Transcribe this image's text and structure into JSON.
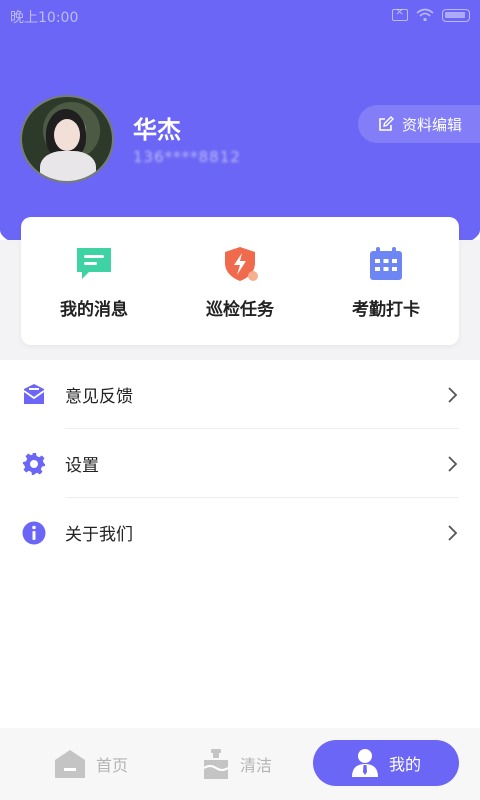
{
  "status_bar": {
    "time": "晚上10:00"
  },
  "profile": {
    "name": "华杰",
    "phone": "136****8812",
    "edit_label": "资料编辑"
  },
  "quick_actions": [
    {
      "label": "我的消息",
      "icon": "message-icon",
      "color": "#3fd3a3"
    },
    {
      "label": "巡检任务",
      "icon": "inspection-shield-icon",
      "color": "#f06a4e"
    },
    {
      "label": "考勤打卡",
      "icon": "calendar-icon",
      "color": "#6e86f4"
    }
  ],
  "menu": [
    {
      "label": "意见反馈",
      "icon": "feedback-mail-icon"
    },
    {
      "label": "设置",
      "icon": "gear-icon"
    },
    {
      "label": "关于我们",
      "icon": "info-icon"
    }
  ],
  "bottom_nav": [
    {
      "label": "首页",
      "icon": "home-icon",
      "active": false
    },
    {
      "label": "清洁",
      "icon": "cleaning-icon",
      "active": false
    },
    {
      "label": "我的",
      "icon": "user-icon",
      "active": true
    }
  ],
  "colors": {
    "accent": "#6b66f5",
    "edit_button": "#837ef7"
  }
}
